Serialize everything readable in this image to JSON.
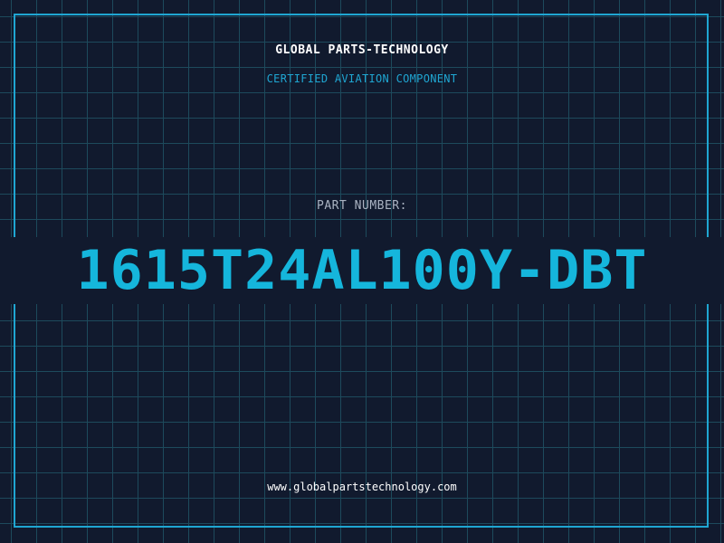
{
  "header": {
    "brand": "GLOBAL PARTS-TECHNOLOGY",
    "tagline": "CERTIFIED AVIATION COMPONENT"
  },
  "part": {
    "label": "PART NUMBER:",
    "number": "1615T24AL100Y-DBT"
  },
  "footer": {
    "url": "www.globalpartstechnology.com"
  },
  "colors": {
    "background": "#111a2e",
    "grid": "#1d4a5c",
    "accent": "#15b6dc",
    "frame": "#1fa6d2",
    "text": "#ffffff",
    "muted": "#aab3c2"
  }
}
